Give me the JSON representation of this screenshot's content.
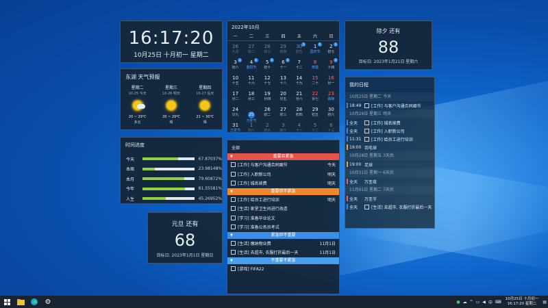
{
  "clock": {
    "time": "16:17:20",
    "date": "10月25日  十月初一  星期二"
  },
  "weather": {
    "title": "东湖 天气预报",
    "days": [
      {
        "name": "星期二",
        "date": "10-25 今天",
        "temp": "20 ~ 29℃",
        "cond": "多云",
        "icon": "partly-cloudy-icon"
      },
      {
        "name": "星期三",
        "date": "10-26 明天",
        "temp": "20 ~ 29℃",
        "cond": "晴",
        "icon": "sun-icon"
      },
      {
        "name": "星期四",
        "date": "10-27 后天",
        "temp": "21 ~ 30℃",
        "cond": "晴",
        "icon": "sun-icon"
      }
    ]
  },
  "progress": {
    "title": "时间进度",
    "rows": [
      {
        "label": "今天",
        "pct": "67.87037%",
        "value": 67.87
      },
      {
        "label": "本周",
        "pct": "23.98148%",
        "value": 23.98
      },
      {
        "label": "本月",
        "pct": "79.60872%",
        "value": 79.61
      },
      {
        "label": "今年",
        "pct": "81.55581%",
        "value": 81.56
      },
      {
        "label": "人生",
        "pct": "45.26952%",
        "value": 45.27
      }
    ]
  },
  "newyear": {
    "head": "元旦 还有",
    "days": "68",
    "target": "目标日: 2023年1月1日 星期日"
  },
  "festival": {
    "head": "除夕 还有",
    "days": "88",
    "target": "目标日: 2023年1月21日 星期六"
  },
  "calendar": {
    "title": "2022年10月",
    "weekdays": [
      "一",
      "二",
      "三",
      "四",
      "五",
      "六",
      "日"
    ],
    "cells": [
      {
        "d": "26",
        "l": "九月",
        "dim": true
      },
      {
        "d": "27",
        "l": "初二",
        "dim": true
      },
      {
        "d": "28",
        "l": "初三",
        "dim": true
      },
      {
        "d": "29",
        "l": "初四",
        "dim": true
      },
      {
        "d": "30",
        "l": "初五",
        "dim": true,
        "badge": "1"
      },
      {
        "d": "1",
        "l": "国庆节",
        "blue": true,
        "badge": "1"
      },
      {
        "d": "2",
        "l": "初七",
        "badge": "1"
      },
      {
        "d": "3",
        "l": "初八",
        "badge": "1"
      },
      {
        "d": "4",
        "l": "重阳节",
        "blue": true,
        "badge": "1"
      },
      {
        "d": "5",
        "l": "初十",
        "badge": "1"
      },
      {
        "d": "6",
        "l": "十一",
        "badge": "1"
      },
      {
        "d": "7",
        "l": "十二"
      },
      {
        "d": "8",
        "l": "寒露",
        "blue": true,
        "red": true
      },
      {
        "d": "9",
        "l": "十四",
        "red": true,
        "badge": "1"
      },
      {
        "d": "10",
        "l": "十五"
      },
      {
        "d": "11",
        "l": "十六"
      },
      {
        "d": "12",
        "l": "十七"
      },
      {
        "d": "13",
        "l": "十八"
      },
      {
        "d": "14",
        "l": "十九"
      },
      {
        "d": "15",
        "l": "二十",
        "red": true
      },
      {
        "d": "16",
        "l": "廿一",
        "red": true
      },
      {
        "d": "17",
        "l": "廿二"
      },
      {
        "d": "18",
        "l": "廿三"
      },
      {
        "d": "19",
        "l": "廿四"
      },
      {
        "d": "20",
        "l": "廿五"
      },
      {
        "d": "21",
        "l": "廿六"
      },
      {
        "d": "22",
        "l": "廿七",
        "red": true
      },
      {
        "d": "23",
        "l": "霜降",
        "blue": true,
        "red": true
      },
      {
        "d": "24",
        "l": "廿九"
      },
      {
        "d": "25",
        "l": "万圣节",
        "blue": true,
        "today": true
      },
      {
        "d": "26",
        "l": "初二"
      },
      {
        "d": "27",
        "l": "初三"
      },
      {
        "d": "28",
        "l": "初四"
      },
      {
        "d": "29",
        "l": "初五"
      },
      {
        "d": "30",
        "l": "初六"
      },
      {
        "d": "31",
        "l": "万圣节",
        "blue": true
      },
      {
        "d": "1",
        "l": "初八",
        "dim": true
      },
      {
        "d": "2",
        "l": "初九",
        "dim": true
      },
      {
        "d": "3",
        "l": "初十",
        "dim": true
      },
      {
        "d": "4",
        "l": "十一",
        "dim": true
      },
      {
        "d": "5",
        "l": "十二",
        "dim": true
      },
      {
        "d": "6",
        "l": "十三",
        "dim": true
      }
    ]
  },
  "schedule": {
    "title": "我的日程",
    "groups": [
      {
        "head": "10月25日 星期二 今天",
        "items": [
          {
            "time": "18:49",
            "check": true,
            "text": "[工作] 与客户沟通合同细节",
            "color": "#2d8cf0"
          }
        ]
      },
      {
        "head": "10月26日 星期三 明天",
        "items": [
          {
            "time": "全天",
            "check": true,
            "text": "[工作] 城名续费",
            "color": "#2d8cf0"
          },
          {
            "time": "全天",
            "check": true,
            "text": "[工作] 入职新公司",
            "color": "#2d8cf0"
          },
          {
            "time": "11:31",
            "check": true,
            "text": "[工作] 给员工进行培训",
            "color": "#2d8cf0"
          },
          {
            "time": "19:00",
            "check": false,
            "text": "羽毛球",
            "color": "#f4a236"
          }
        ]
      },
      {
        "head": "10月28日 星期五 3天后",
        "items": [
          {
            "time": "19:00",
            "check": false,
            "text": "足球",
            "color": "#f4a236"
          }
        ]
      },
      {
        "head": "10月31日 星期一 6天后",
        "items": [
          {
            "time": "全天",
            "check": false,
            "text": "万圣夜",
            "color": "#f25c5c"
          }
        ]
      },
      {
        "head": "11月01日 星期二 7天后",
        "items": [
          {
            "time": "全天",
            "check": false,
            "text": "万圣节",
            "color": "#f25c5c"
          },
          {
            "time": "全天",
            "check": true,
            "text": "[生活] 去超市, 衣服打折最后一天",
            "color": "#2d8cf0"
          }
        ]
      }
    ]
  },
  "todo": {
    "title": "全部",
    "groups": [
      {
        "head": "重要且紧急",
        "color": "#e5534b",
        "items": [
          {
            "text": "[工作] 与客户沟通合同细节",
            "due": "今天"
          },
          {
            "text": "[工作] 入职新公司",
            "due": "明天"
          },
          {
            "text": "[工作] 城名续费",
            "due": "明天"
          }
        ]
      },
      {
        "head": "重要但不紧急",
        "color": "#f0882a",
        "items": [
          {
            "text": "[工作] 给员工进行培训",
            "due": "明天"
          },
          {
            "text": "[生活] 家里卫生间进行改造",
            "due": ""
          },
          {
            "text": "[学习] 准备毕业论文",
            "due": ""
          },
          {
            "text": "[学习] 准备公务员考试",
            "due": ""
          }
        ]
      },
      {
        "head": "紧急但不重要",
        "color": "#3a8ee6",
        "items": [
          {
            "text": "[生活] 缴纳物业费",
            "due": "11月1日"
          },
          {
            "text": "[生活] 去超市, 衣服打折最后一天",
            "due": "11月1日"
          }
        ]
      },
      {
        "head": "不重要不紧急",
        "color": "#4a9de8",
        "items": [
          {
            "text": "[游戏] FIFA22",
            "due": ""
          }
        ]
      }
    ]
  },
  "taskbar": {
    "tray_lang": "中",
    "tray_date": "10月25日 十月初一",
    "tray_time": "16:17:20 星期二"
  }
}
